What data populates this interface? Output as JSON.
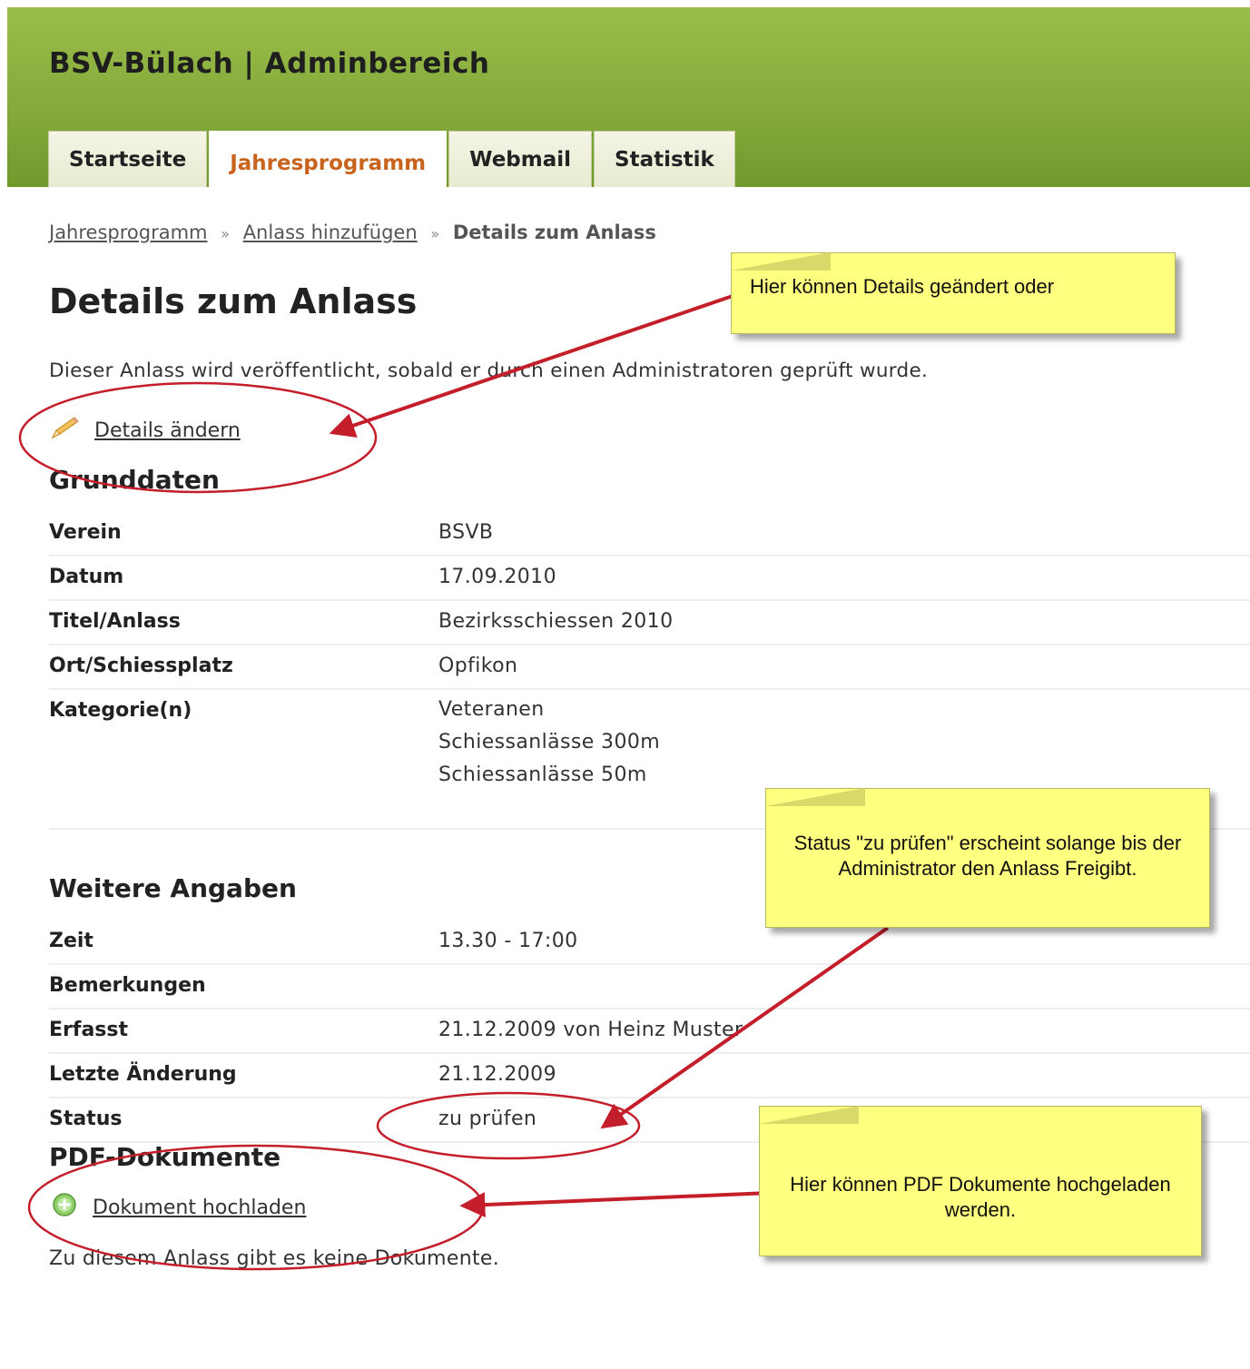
{
  "header": {
    "title": "BSV-Bülach | Adminbereich"
  },
  "tabs": [
    {
      "label": "Startseite"
    },
    {
      "label": "Jahresprogramm"
    },
    {
      "label": "Webmail"
    },
    {
      "label": "Statistik"
    }
  ],
  "breadcrumb": [
    {
      "label": "Jahresprogramm"
    },
    {
      "label": "Anlass hinzufügen"
    },
    {
      "label": "Details zum Anlass"
    }
  ],
  "breadcrumb_separator": "»",
  "page": {
    "title": "Details zum Anlass",
    "intro": "Dieser Anlass wird veröffentlicht, sobald er durch einen Administratoren geprüft wurde.",
    "edit_link": "Details ändern"
  },
  "grunddaten": {
    "heading": "Grunddaten",
    "rows": [
      {
        "label": "Verein",
        "value": "BSVB"
      },
      {
        "label": "Datum",
        "value": "17.09.2010"
      },
      {
        "label": "Titel/Anlass",
        "value": "Bezirksschiessen 2010"
      },
      {
        "label": "Ort/Schiessplatz",
        "value": "Opfikon"
      }
    ],
    "categories_label": "Kategorie(n)",
    "categories": [
      "Veteranen",
      "Schiessanlässe 300m",
      "Schiessanlässe 50m"
    ]
  },
  "weitere": {
    "heading": "Weitere Angaben",
    "rows": [
      {
        "label": "Zeit",
        "value": "13.30 - 17:00"
      },
      {
        "label": "Bemerkungen",
        "value": ""
      },
      {
        "label": "Erfasst",
        "value": "21.12.2009 von Heinz Muster"
      },
      {
        "label": "Letzte Änderung",
        "value": "21.12.2009"
      },
      {
        "label": "Status",
        "value": "zu prüfen"
      }
    ]
  },
  "pdf": {
    "heading": "PDF-Dokumente",
    "upload_link": "Dokument hochladen",
    "empty_text": "Zu diesem Anlass gibt es keine Dokumente."
  },
  "annotations": {
    "note1": "Hier können Details geändert oder",
    "note2": "Status \"zu prüfen\" erscheint solange bis der Administrator den Anlass Freigibt.",
    "note3": "Hier können PDF Dokumente hochgeladen werden.",
    "color": "#c41e2a",
    "note_color": "#ffff80"
  },
  "icons": {
    "edit": "pencil-icon",
    "upload": "add-circle-icon"
  }
}
